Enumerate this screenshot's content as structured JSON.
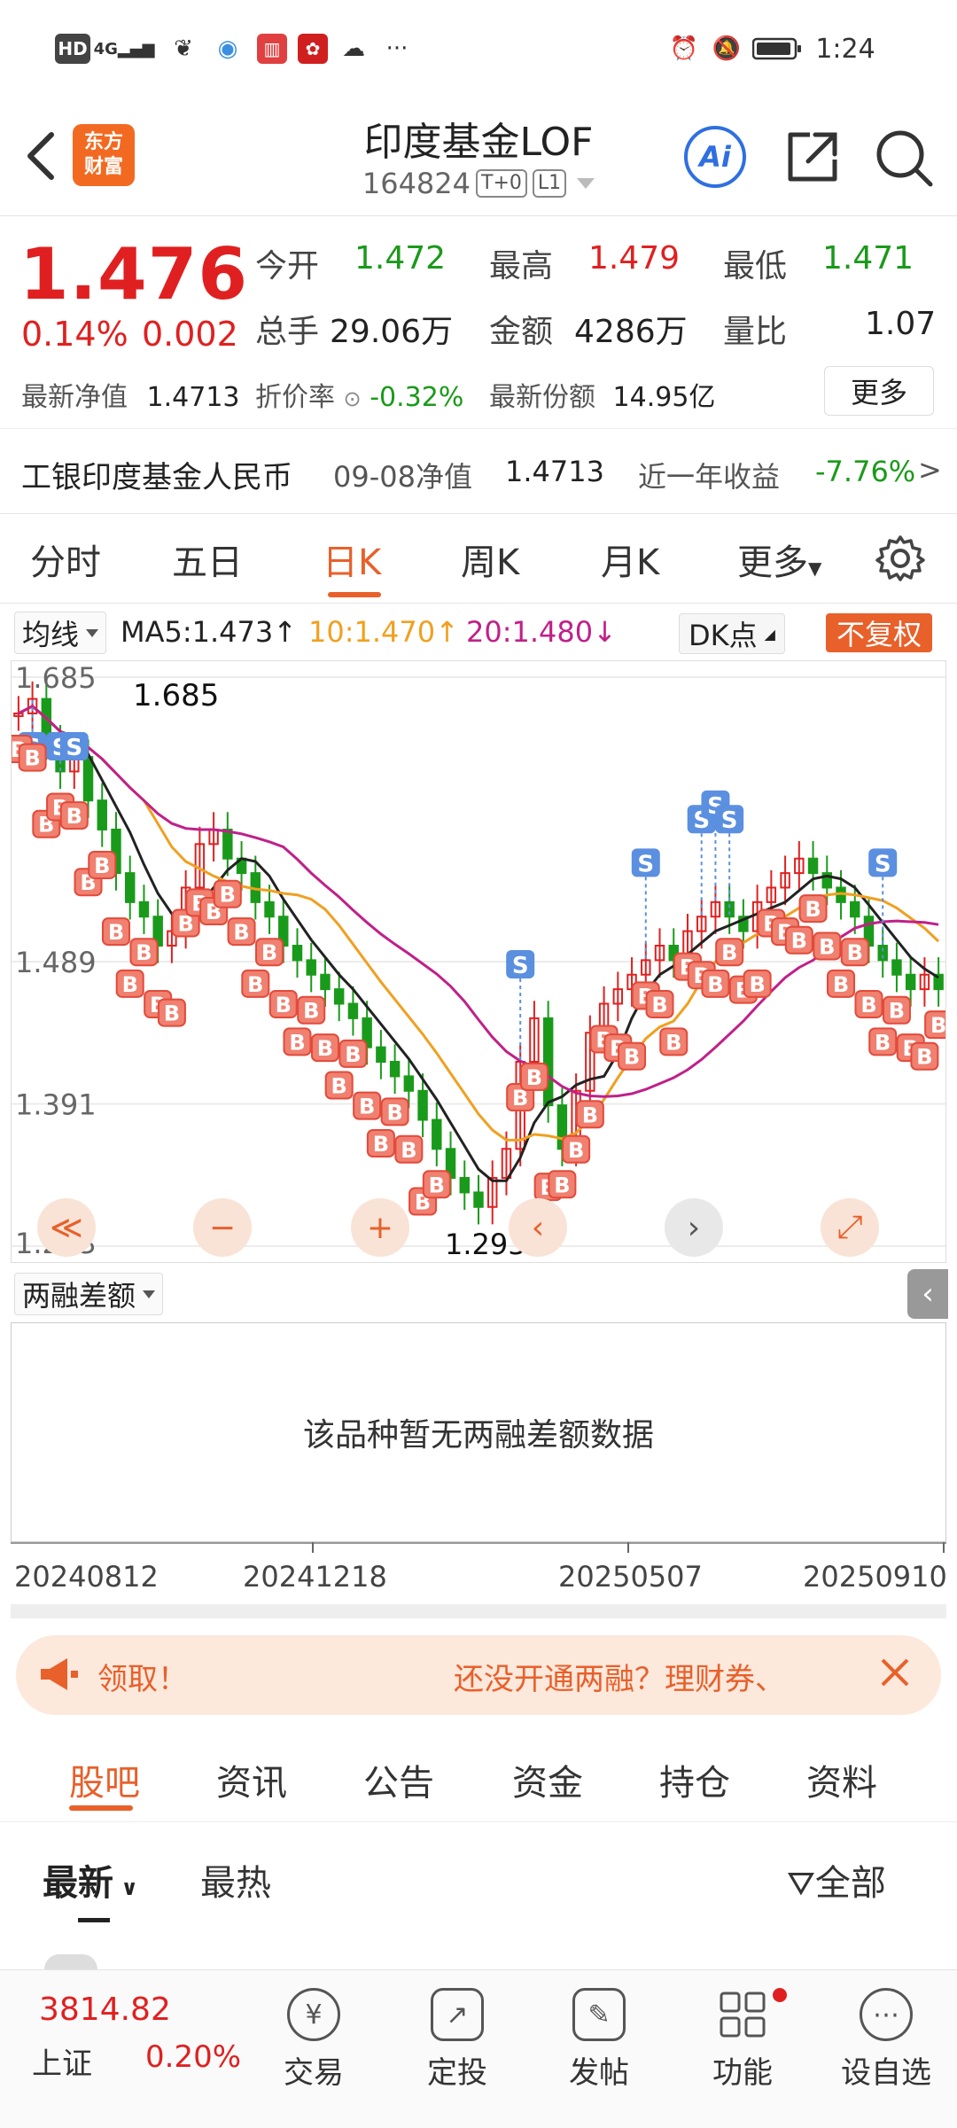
{
  "status_bar": {
    "hd": "HD",
    "network": "4G",
    "more": "···",
    "time": "1:24"
  },
  "header": {
    "logo_text_line1": "东方",
    "logo_text_line2": "财富",
    "title": "印度基金LOF",
    "code": "164824",
    "tag_t0": "T+0",
    "tag_l1": "L1",
    "ai_label": "Ai"
  },
  "quote": {
    "price": "1.476",
    "change_pct": "0.14%",
    "change_abs": "0.002",
    "open_label": "今开",
    "open": "1.472",
    "high_label": "最高",
    "high": "1.479",
    "low_label": "最低",
    "low": "1.471",
    "volume_label": "总手",
    "volume": "29.06万",
    "amount_label": "金额",
    "amount": "4286万",
    "ratio_label": "量比",
    "ratio": "1.07",
    "nav_label": "最新净值",
    "nav": "1.4713",
    "discount_label": "折价率",
    "discount": "-0.32%",
    "shares_label": "最新份额",
    "shares": "14.95亿",
    "more_btn": "更多"
  },
  "related": {
    "name": "工银印度基金人民币",
    "nav_date_label": "09-08净值",
    "nav": "1.4713",
    "yield_label": "近一年收益",
    "yield": "-7.76%",
    "arrow": ">"
  },
  "tabs": [
    "分时",
    "五日",
    "日K",
    "周K",
    "月K",
    "更多"
  ],
  "active_tab": "日K",
  "indicators": {
    "ma_selector": "均线",
    "ma5": "MA5:1.473",
    "ma10": "10:1.470",
    "ma20": "20:1.480",
    "dk": "DK点",
    "fq": "不复权",
    "colors": {
      "ma5": "#222222",
      "ma10": "#f0a020",
      "ma20": "#c0208a",
      "fq_bg": "#e8602a"
    }
  },
  "chart_data": {
    "type": "candlestick",
    "y_ticks": [
      "1.685",
      "1.489",
      "1.391",
      "1.293"
    ],
    "ylim": [
      1.293,
      1.685
    ],
    "high_annotation": "1.685",
    "low_annotation": "1.293->",
    "x_ticks": [
      "20240812",
      "20241218",
      "20250507",
      "20250910"
    ],
    "closes": [
      1.66,
      1.67,
      1.64,
      1.62,
      1.63,
      1.6,
      1.58,
      1.55,
      1.53,
      1.52,
      1.5,
      1.51,
      1.54,
      1.57,
      1.58,
      1.56,
      1.55,
      1.53,
      1.52,
      1.5,
      1.49,
      1.48,
      1.47,
      1.46,
      1.45,
      1.43,
      1.42,
      1.41,
      1.4,
      1.38,
      1.36,
      1.34,
      1.33,
      1.32,
      1.34,
      1.36,
      1.42,
      1.45,
      1.39,
      1.36,
      1.4,
      1.44,
      1.46,
      1.47,
      1.48,
      1.49,
      1.5,
      1.49,
      1.51,
      1.52,
      1.53,
      1.52,
      1.51,
      1.53,
      1.54,
      1.55,
      1.56,
      1.55,
      1.54,
      1.53,
      1.52,
      1.5,
      1.49,
      1.48,
      1.47,
      1.48,
      1.47
    ],
    "markers": {
      "S_count": 14,
      "B_count": 60
    },
    "series": [
      {
        "name": "MA5",
        "color": "#222222"
      },
      {
        "name": "MA10",
        "color": "#f0a020"
      },
      {
        "name": "MA20",
        "color": "#c0208a"
      }
    ]
  },
  "chart_controls": {
    "prev": "≪",
    "zoom_out": "−",
    "zoom_in": "+",
    "left": "‹",
    "right": "›",
    "expand": "⤢"
  },
  "margin": {
    "selector": "两融差额",
    "empty_text": "该品种暂无两融差额数据",
    "x_labels": [
      "20240812",
      "20241218",
      "20250507",
      "20250910"
    ]
  },
  "banner": {
    "left_text": "领取！",
    "right_text": "还没开通两融？理财券、"
  },
  "section_tabs": [
    "股吧",
    "资讯",
    "公告",
    "资金",
    "持仓",
    "资料"
  ],
  "active_section": "股吧",
  "filter": {
    "latest": "最新",
    "hot": "最热",
    "all": "全部"
  },
  "bottom_bar": {
    "index_value": "3814.82",
    "index_name": "上证",
    "index_change": "0.20%",
    "items": [
      "交易",
      "定投",
      "发帖",
      "功能",
      "设自选"
    ],
    "icons": [
      "yen-icon",
      "chart-icon",
      "edit-icon",
      "grid-icon",
      "more-dots-icon"
    ]
  }
}
